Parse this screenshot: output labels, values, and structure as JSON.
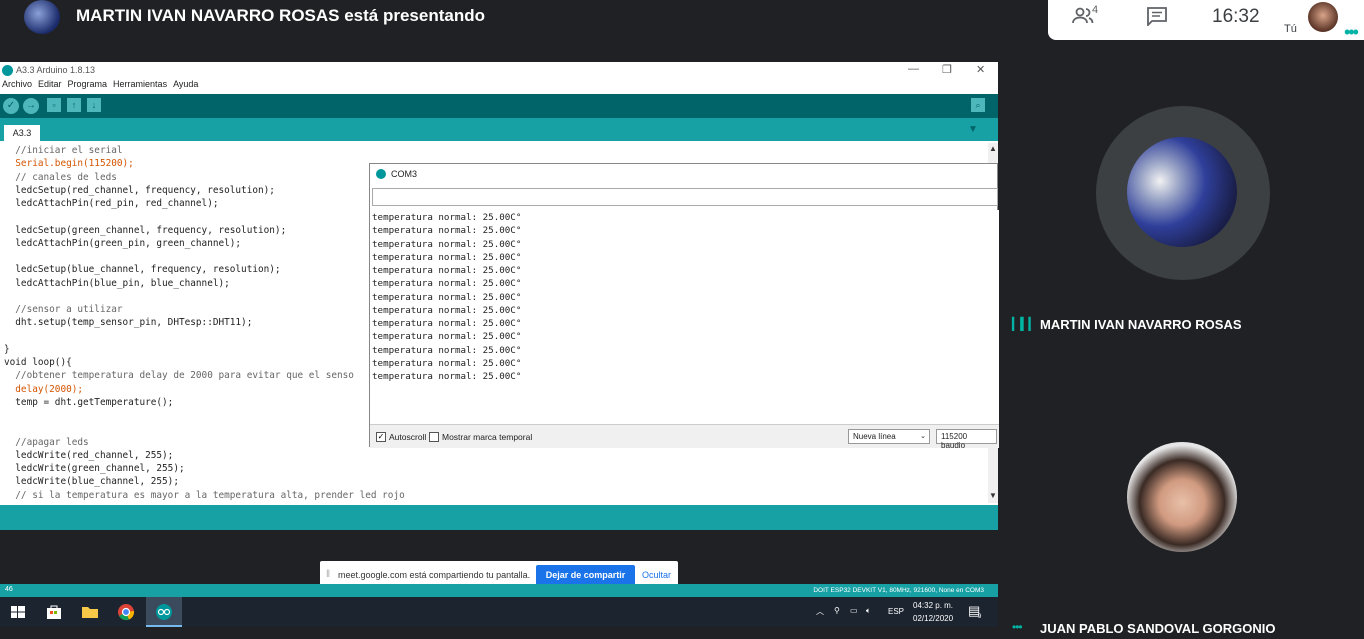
{
  "meet": {
    "presenter_title": "MARTIN IVAN NAVARRO ROSAS está presentando",
    "people_count": "4",
    "time": "16:32",
    "self_label": "Tú",
    "participants": [
      {
        "name": "MARTIN IVAN NAVARRO ROSAS"
      },
      {
        "name": "JUAN PABLO SANDOVAL GORGONIO"
      }
    ],
    "icons": [
      "people-icon",
      "chat-icon",
      "more-icon",
      "speaking-icon"
    ],
    "accent_color": "#00b3a4"
  },
  "arduino": {
    "title": "A3.3 Arduino 1.8.13",
    "menu": [
      "Archivo",
      "Editar",
      "Programa",
      "Herramientas",
      "Ayuda"
    ],
    "toolbar": [
      "verify",
      "upload",
      "new",
      "open",
      "save"
    ],
    "tab": "A3.3",
    "line_number": "46",
    "board_info": "DOIT ESP32 DEVKIT V1, 80MHz, 921600, None en COM3",
    "code_lines": [
      {
        "c": "  //iniciar el serial",
        "t": "cm"
      },
      {
        "c": "  Serial.begin(115200);",
        "t": "kw"
      },
      {
        "c": "  // canales de leds",
        "t": "cm"
      },
      {
        "c": "  ledcSetup(red_channel, frequency, resolution);",
        "t": ""
      },
      {
        "c": "  ledcAttachPin(red_pin, red_channel);",
        "t": ""
      },
      {
        "c": "",
        "t": ""
      },
      {
        "c": "  ledcSetup(green_channel, frequency, resolution);",
        "t": ""
      },
      {
        "c": "  ledcAttachPin(green_pin, green_channel);",
        "t": ""
      },
      {
        "c": "",
        "t": ""
      },
      {
        "c": "  ledcSetup(blue_channel, frequency, resolution);",
        "t": ""
      },
      {
        "c": "  ledcAttachPin(blue_pin, blue_channel);",
        "t": ""
      },
      {
        "c": "",
        "t": ""
      },
      {
        "c": "  //sensor a utilizar",
        "t": "cm"
      },
      {
        "c": "  dht.setup(temp_sensor_pin, DHTesp::DHT11);",
        "t": ""
      },
      {
        "c": "",
        "t": ""
      },
      {
        "c": "}",
        "t": ""
      },
      {
        "c": "void loop(){",
        "t": ""
      },
      {
        "c": "  //obtener temperatura delay de 2000 para evitar que el senso",
        "t": "cm"
      },
      {
        "c": "  delay(2000);",
        "t": "kw"
      },
      {
        "c": "  temp = dht.getTemperature();",
        "t": ""
      },
      {
        "c": "",
        "t": ""
      },
      {
        "c": "",
        "t": ""
      },
      {
        "c": "  //apagar leds",
        "t": "cm"
      },
      {
        "c": "  ledcWrite(red_channel, 255);",
        "t": ""
      },
      {
        "c": "  ledcWrite(green_channel, 255);",
        "t": ""
      },
      {
        "c": "  ledcWrite(blue_channel, 255);",
        "t": ""
      },
      {
        "c": "  // si la temperatura es mayor a la temperatura alta, prender led rojo",
        "t": "cm"
      }
    ]
  },
  "serial": {
    "title": "COM3",
    "lines": [
      "temperatura normal: 25.00C°",
      "temperatura normal: 25.00C°",
      "temperatura normal: 25.00C°",
      "temperatura normal: 25.00C°",
      "temperatura normal: 25.00C°",
      "temperatura normal: 25.00C°",
      "temperatura normal: 25.00C°",
      "temperatura normal: 25.00C°",
      "temperatura normal: 25.00C°",
      "temperatura normal: 25.00C°",
      "temperatura normal: 25.00C°",
      "temperatura normal: 25.00C°",
      "temperatura normal: 25.00C°"
    ],
    "autoscroll_label": "Autoscroll",
    "timestamp_label": "Mostrar marca temporal",
    "line_ending": "Nueva línea",
    "baud": "115200 baudio"
  },
  "share_bar": {
    "text": "meet.google.com está compartiendo tu pantalla.",
    "stop_label": "Dejar de compartir",
    "hide_label": "Ocultar"
  },
  "taskbar": {
    "language": "ESP",
    "time": "04:32 p. m.",
    "date": "02/12/2020",
    "notification_count": "9"
  }
}
